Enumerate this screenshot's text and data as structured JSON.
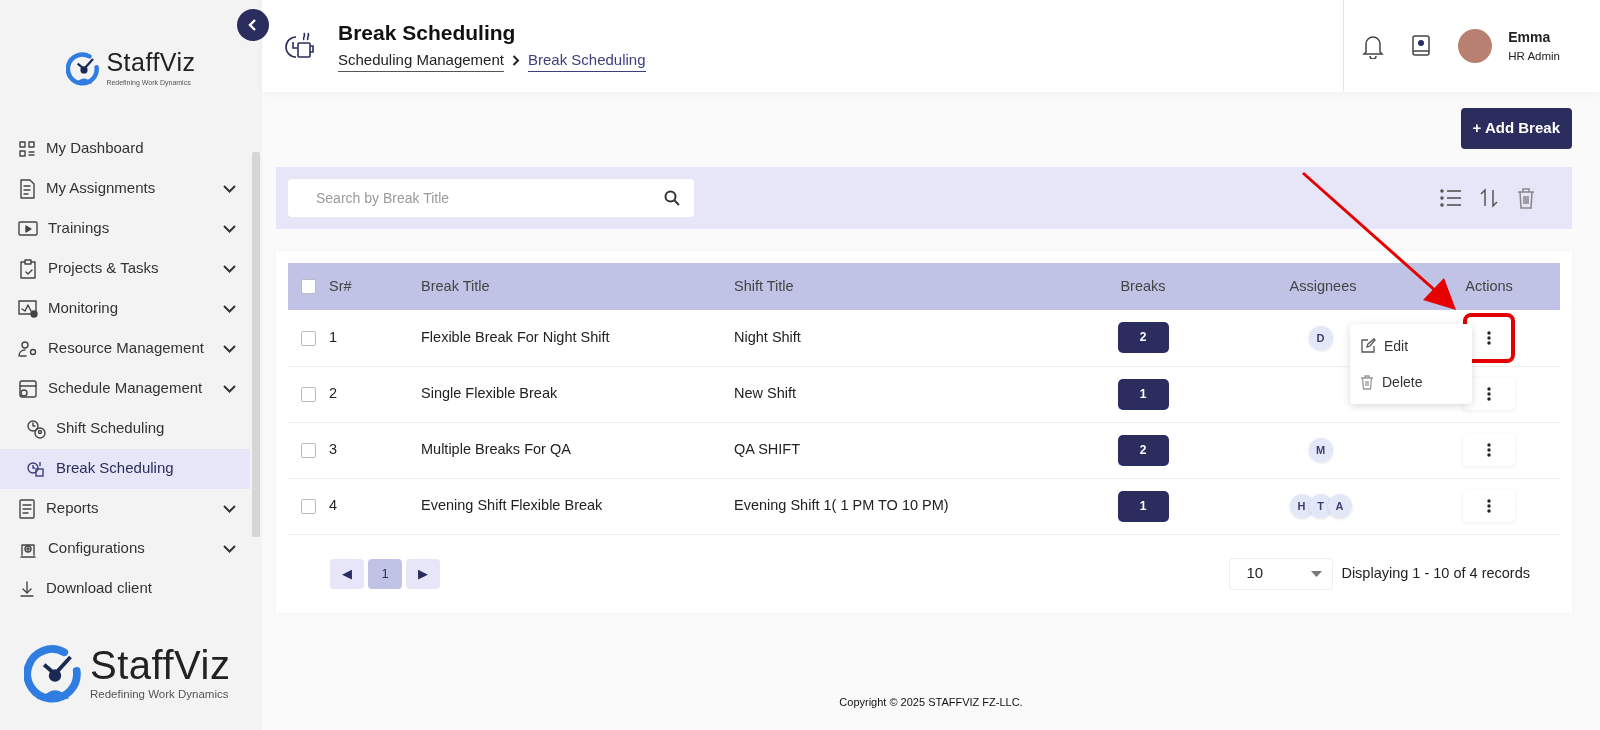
{
  "sidebar": {
    "logo": {
      "name": "StaffViz",
      "tagline": "Redefining Work Dynamics"
    },
    "items": [
      {
        "label": "My Dashboard",
        "expandable": false,
        "selected": false
      },
      {
        "label": "My Assignments",
        "expandable": true,
        "selected": false
      },
      {
        "label": "Trainings",
        "expandable": true,
        "selected": false
      },
      {
        "label": "Projects & Tasks",
        "expandable": true,
        "selected": false
      },
      {
        "label": "Monitoring",
        "expandable": true,
        "selected": false
      },
      {
        "label": "Resource Management",
        "expandable": true,
        "selected": false
      },
      {
        "label": "Schedule Management",
        "expandable": true,
        "selected": false,
        "children": [
          {
            "label": "Shift Scheduling",
            "selected": false
          },
          {
            "label": "Break Scheduling",
            "selected": true
          }
        ]
      },
      {
        "label": "Reports",
        "expandable": true,
        "selected": false
      },
      {
        "label": "Configurations",
        "expandable": true,
        "selected": false
      },
      {
        "label": "Download client",
        "expandable": false,
        "selected": false
      }
    ],
    "footer_logo": {
      "name": "StaffViz",
      "tagline": "Redefining Work Dynamics"
    }
  },
  "header": {
    "title": "Break Scheduling",
    "breadcrumb": [
      "Scheduling Management",
      "Break Scheduling"
    ],
    "user": {
      "name": "Emma",
      "role": "HR Admin"
    }
  },
  "add_button": "+ Add Break",
  "search": {
    "placeholder": "Search by Break Title"
  },
  "table": {
    "columns": [
      "Sr#",
      "Break Title",
      "Shift Title",
      "Breaks",
      "Assignees",
      "Actions"
    ],
    "header_checked": false,
    "rows": [
      {
        "checked": false,
        "sr": "1",
        "break_title": "Flexible Break For Night Shift",
        "shift_title": "Night Shift",
        "breaks": "2",
        "assignees": [
          "D"
        ],
        "menu_open": true,
        "highlighted": true
      },
      {
        "checked": false,
        "sr": "2",
        "break_title": "Single Flexible Break",
        "shift_title": "New Shift",
        "breaks": "1",
        "menu_open": false,
        "highlighted": false
      },
      {
        "checked": false,
        "sr": "3",
        "break_title": "Multiple Breaks For QA",
        "shift_title": "QA SHIFT",
        "breaks": "2",
        "assignees": [
          "M"
        ],
        "menu_open": false,
        "highlighted": false
      },
      {
        "checked": false,
        "sr": "4",
        "break_title": "Evening Shift Flexible Break",
        "shift_title": "Evening Shift 1( 1 PM TO 10 PM)",
        "breaks": "1",
        "assignees": [
          "H",
          "T",
          "A"
        ],
        "menu_open": false,
        "highlighted": false
      }
    ]
  },
  "action_menu": [
    {
      "label": "Edit",
      "kind": "edit"
    },
    {
      "label": "Delete",
      "kind": "delete"
    }
  ],
  "pagination": {
    "prev": "◀",
    "next": "▶",
    "pages": [
      {
        "label": "1",
        "selected": true
      }
    ],
    "page_size": "10",
    "summary": "Displaying 1 - 10 of 4 records"
  },
  "footer": "Copyright © 2025 STAFFVIZ FZ-LLC."
}
